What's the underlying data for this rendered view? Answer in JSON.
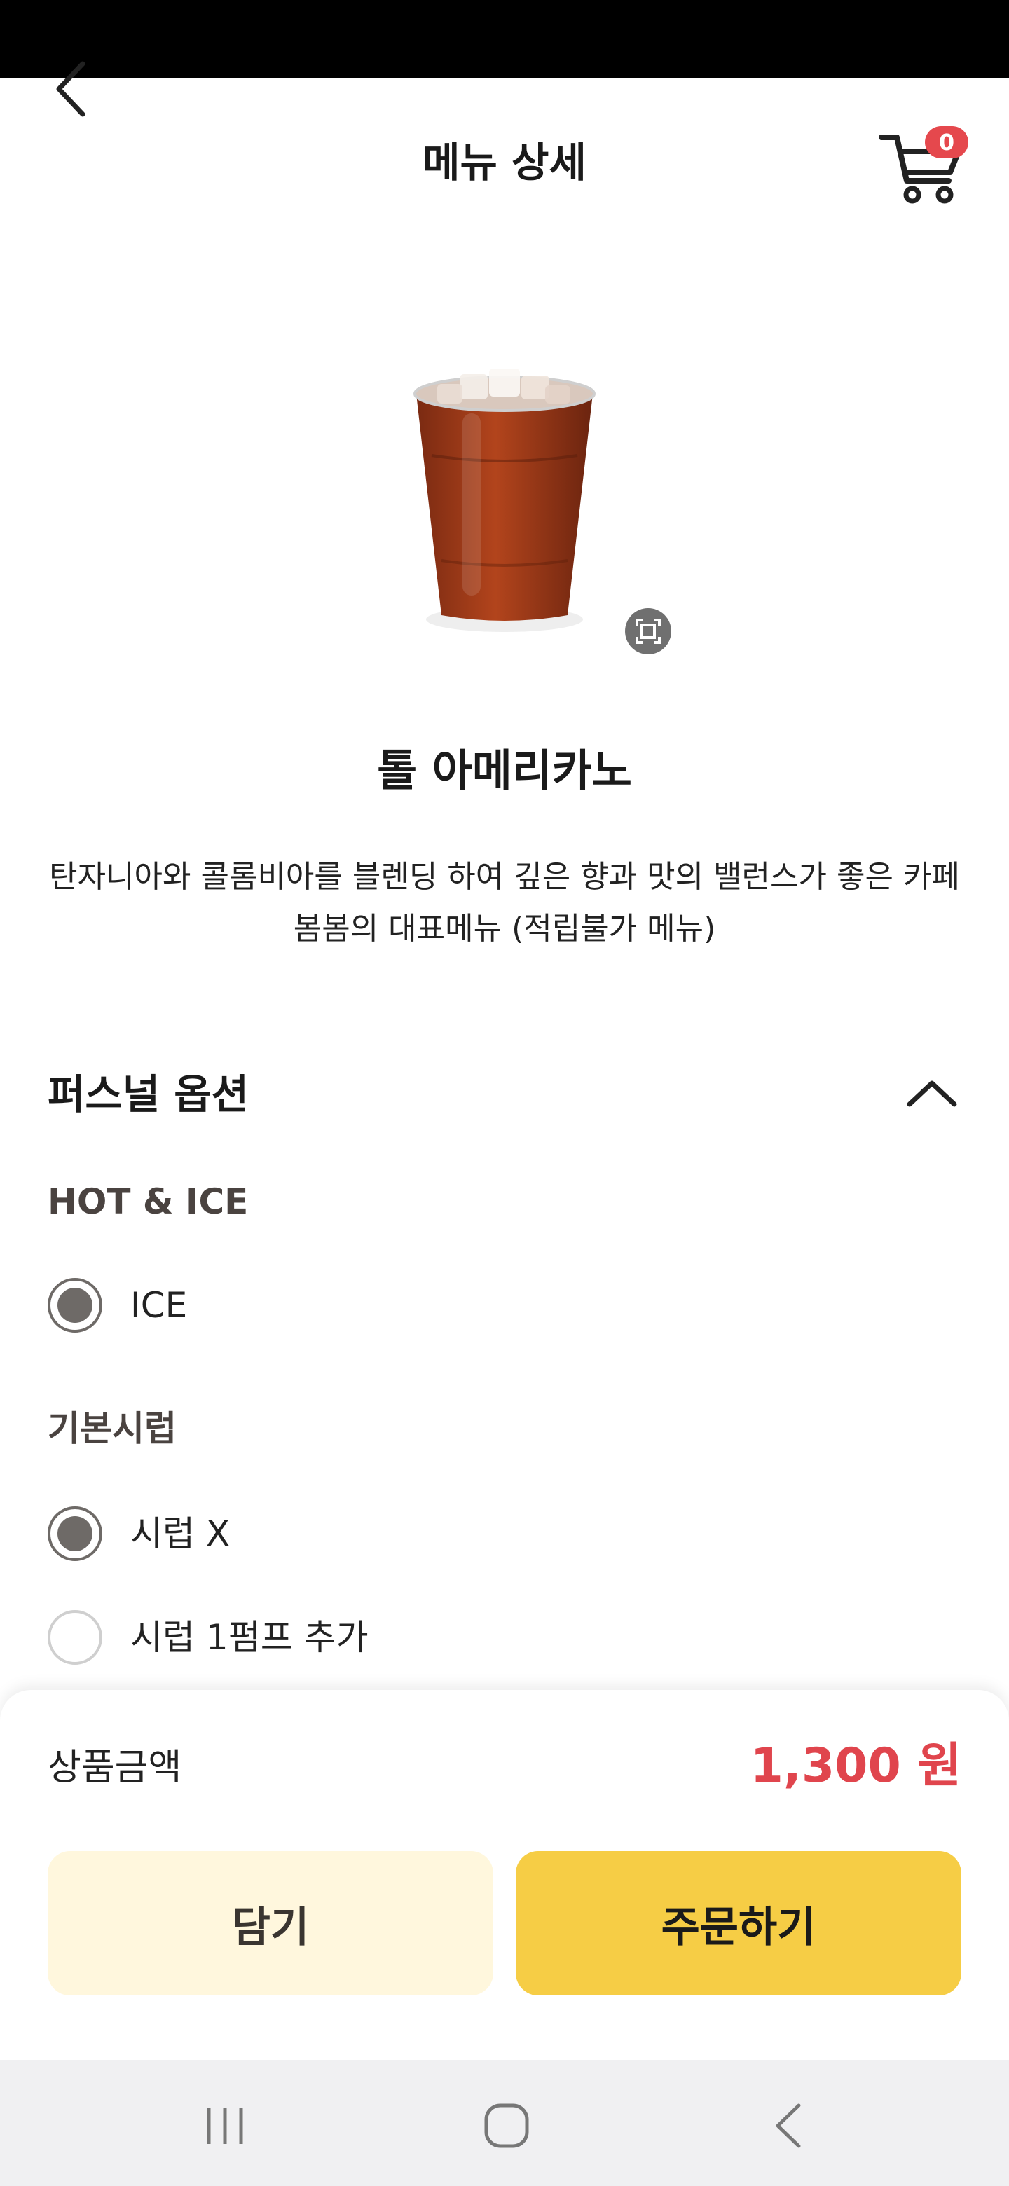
{
  "header": {
    "title": "메뉴 상세",
    "cart_count": "0",
    "back_icon": "chevron-left-icon",
    "cart_icon": "cart-icon"
  },
  "product": {
    "name": "톨 아메리카노",
    "description": "탄자니아와 콜롬비아를 블렌딩 하여 깊은 향과 맛의 밸런스가 좋은 카페봄봄의 대표메뉴 (적립불가 메뉴)",
    "image": "iced-americano-cup"
  },
  "options": {
    "section_title": "퍼스널 옵션",
    "collapse_icon": "chevron-up-icon",
    "groups": [
      {
        "title": "HOT & ICE",
        "choices": [
          {
            "label": "ICE",
            "selected": true
          }
        ]
      },
      {
        "title": "기본시럽",
        "choices": [
          {
            "label": "시럽 X",
            "selected": true
          },
          {
            "label": "시럽 1펌프 추가",
            "selected": false
          }
        ]
      }
    ]
  },
  "footer": {
    "price_label": "상품금액",
    "price_value": "1,300 원",
    "cart_button": "담기",
    "order_button": "주문하기",
    "accent_color": "#f6cd45",
    "price_color": "#e0454d"
  },
  "system_nav": {
    "recent_icon": "recent-apps-icon",
    "home_icon": "home-icon",
    "back_icon": "back-icon"
  }
}
